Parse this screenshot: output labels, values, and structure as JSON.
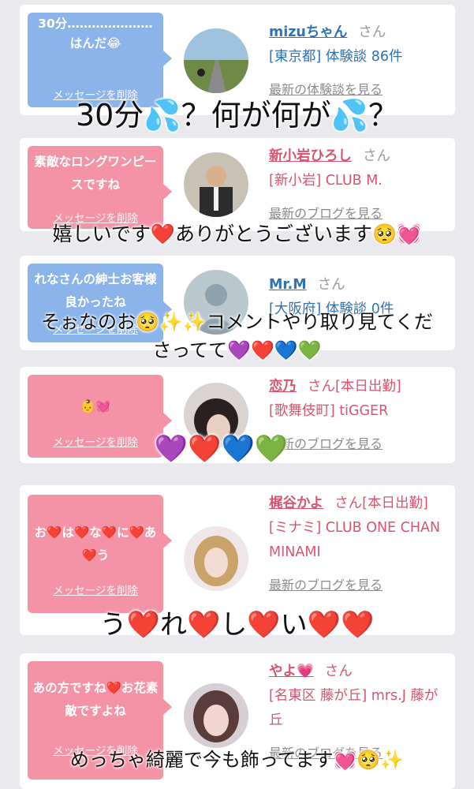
{
  "cards": [
    {
      "bubble_text": "30分…………………はんだ😂",
      "delete_label": "メッセージを削除",
      "name": "mizuちゃん",
      "san": "さん",
      "detail": "[東京都] 体験談 86件",
      "link": "最新の体験談を見る"
    },
    {
      "bubble_text": "素敵なロングワンピースですね",
      "delete_label": "メッセージを削除",
      "name": "新小岩ひろし",
      "san": "さん",
      "detail": "[新小岩] CLUB M.",
      "link": "最新のブログを見る"
    },
    {
      "bubble_text": "れなさんの紳士お客様良かったね",
      "delete_label": "メッセージを削除",
      "name": "Mr.M",
      "san": "さん",
      "detail": "[大阪府] 体験談 0件",
      "link": "",
      "avatar_label": "no photo"
    },
    {
      "bubble_text": "👶💓",
      "delete_label": "メッセージを削除",
      "name": "恋乃",
      "san": "さん[本日出勤]",
      "detail": "[歌舞伎町] tiGGER",
      "link": "最新のブログを見る"
    },
    {
      "bubble_text": "お❤️は❤️な❤️に❤️あ❤️う",
      "delete_label": "メッセージを削除",
      "name": "梶谷かよ",
      "san": "さん[本日出勤]",
      "detail": "[ミナミ] CLUB ONE CHAN MINAMI",
      "link": "最新のブログを見る"
    },
    {
      "bubble_text": "あの方ですね❤️お花素敵ですよね",
      "delete_label": "メッセージを削除",
      "name": "やよ💗",
      "san": "さん",
      "detail": "[名東区 藤が丘] mrs.J 藤が丘",
      "link": "最新のブログを見る"
    }
  ],
  "overlays": [
    "30分💦？何が何が💦？",
    "嬉しいです❤️ありがとうございます🥺💓",
    "そぉなのお🥺✨✨コメントやり取り見てくだ",
    "さってて💜❤️💙💚",
    "💜❤️💙💚",
    "う❤️れ❤️し❤️い❤️❤️",
    "めっちゃ綺麗で今も飾ってます💓🥺✨"
  ],
  "colors": {
    "blue_bubble": "#8ab4ea",
    "pink_bubble": "#f493a6",
    "blue_text": "#2d73b6",
    "pink_text": "#d9546e"
  }
}
